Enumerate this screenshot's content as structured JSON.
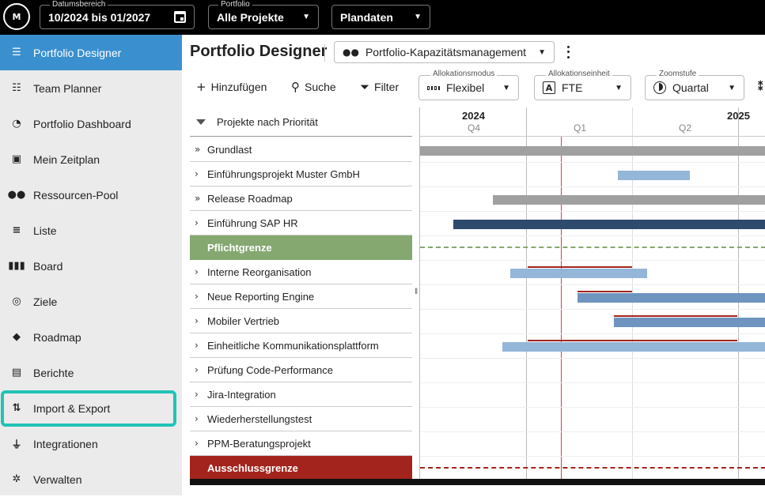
{
  "topbar": {
    "logo": "M",
    "date_range": {
      "label": "Datumsbereich",
      "value": "10/2024 bis 01/2027"
    },
    "portfolio": {
      "label": "Portfolio",
      "value": "Alle Projekte"
    },
    "data_type": {
      "value": "Plandaten"
    }
  },
  "sidebar": {
    "items": [
      {
        "label": "Portfolio Designer",
        "icon": "portfolio-designer-icon",
        "active": true
      },
      {
        "label": "Team Planner",
        "icon": "team-planner-icon"
      },
      {
        "label": "Portfolio Dashboard",
        "icon": "dashboard-icon"
      },
      {
        "label": "Mein Zeitplan",
        "icon": "my-schedule-icon"
      },
      {
        "label": "Ressourcen-Pool",
        "icon": "resource-pool-icon"
      },
      {
        "label": "Liste",
        "icon": "list-icon"
      },
      {
        "label": "Board",
        "icon": "board-icon"
      },
      {
        "label": "Ziele",
        "icon": "goals-icon"
      },
      {
        "label": "Roadmap",
        "icon": "roadmap-icon"
      },
      {
        "label": "Berichte",
        "icon": "reports-icon"
      },
      {
        "label": "Import & Export",
        "icon": "import-export-icon",
        "highlighted": true
      },
      {
        "label": "Integrationen",
        "icon": "integrations-icon"
      },
      {
        "label": "Verwalten",
        "icon": "settings-icon"
      }
    ]
  },
  "header": {
    "title": "Portfolio Designer",
    "view": "Portfolio-Kapazitätsmanagement"
  },
  "toolbar": {
    "add": "Hinzufügen",
    "search": "Suche",
    "filter": "Filter",
    "allocation_mode": {
      "label": "Allokationsmodus",
      "value": "Flexibel"
    },
    "allocation_unit": {
      "label": "Allokationseinheit",
      "value": "FTE"
    },
    "zoom": {
      "label": "Zoomstufe",
      "value": "Quartal"
    }
  },
  "list": {
    "header": "Projekte nach Priorität",
    "rows": [
      {
        "name": "Grundlast",
        "chevron": "double"
      },
      {
        "name": "Einführungsprojekt Muster GmbH",
        "chevron": "single"
      },
      {
        "name": "Release Roadmap",
        "chevron": "double"
      },
      {
        "name": "Einführung SAP HR",
        "chevron": "single"
      },
      {
        "name": "Pflichtgrenze",
        "type": "threshold-green"
      },
      {
        "name": "Interne Reorganisation",
        "chevron": "single"
      },
      {
        "name": "Neue Reporting Engine",
        "chevron": "single"
      },
      {
        "name": "Mobiler Vertrieb",
        "chevron": "single"
      },
      {
        "name": "Einheitliche Kommunikationsplattform",
        "chevron": "single"
      },
      {
        "name": "Prüfung Code-Performance",
        "chevron": "single"
      },
      {
        "name": "Jira-Integration",
        "chevron": "single"
      },
      {
        "name": "Wiederherstellungstest",
        "chevron": "single"
      },
      {
        "name": "PPM-Beratungsprojekt",
        "chevron": "single"
      },
      {
        "name": "Ausschlussgrenze",
        "type": "threshold-red"
      }
    ]
  },
  "timeline": {
    "years": [
      "2024",
      "2025"
    ],
    "quarters": [
      "Q4",
      "Q1",
      "Q2"
    ],
    "colors": {
      "gray": "#a0a0a0",
      "light_blue": "#94b6d8",
      "mid_blue": "#6e94bf",
      "dark_blue": "#2e4b6e",
      "green_dash": "#84a870",
      "red": "#a3241c"
    }
  }
}
